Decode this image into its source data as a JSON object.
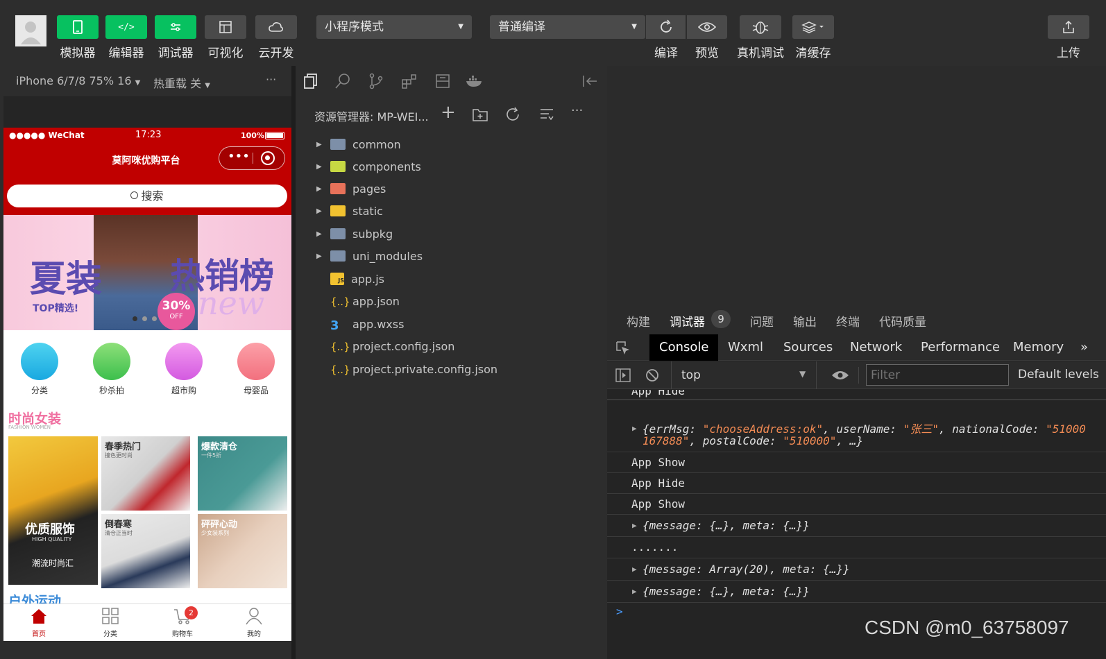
{
  "toolbar": {
    "left_buttons": [
      {
        "label": "模拟器",
        "icon": "phone-icon"
      },
      {
        "label": "编辑器",
        "icon": "code-icon"
      },
      {
        "label": "调试器",
        "icon": "debugger-icon"
      },
      {
        "label": "可视化",
        "icon": "layout-icon"
      },
      {
        "label": "云开发",
        "icon": "cloud-icon"
      }
    ],
    "mode_select": "小程序模式",
    "compile_select": "普通编译",
    "right_buttons": [
      {
        "label": "编译",
        "icon": "refresh-icon"
      },
      {
        "label": "预览",
        "icon": "eye-icon"
      },
      {
        "label": "真机调试",
        "icon": "bug-icon"
      },
      {
        "label": "清缓存",
        "icon": "layers-icon"
      }
    ],
    "upload_label": "上传"
  },
  "simulator": {
    "device": "iPhone 6/7/8 75% 16",
    "hot_reload": "热重载 关",
    "more": "···",
    "status": {
      "carrier": "●●●●● WeChat",
      "time": "17:23",
      "battery": "100%"
    },
    "nav_title": "莫阿咪优购平台",
    "search_placeholder": "搜索",
    "banner": {
      "left": "夏装",
      "right": "热销榜",
      "sub": "TOP精选!",
      "badge": "30%",
      "badge_sub": "OFF",
      "script": "new"
    },
    "categories": [
      "分类",
      "秒杀拍",
      "超市购",
      "母婴品"
    ],
    "section1": {
      "title": "时尚女装",
      "sub": "FASHION WOMEN"
    },
    "tiles": [
      {
        "title": "优质服饰",
        "sub": "HIGH QUALITY",
        "sub2": "潮流时尚汇"
      },
      {
        "title": "春季热门",
        "sub": "撞色更时尚"
      },
      {
        "title": "爆款清仓",
        "sub": "一件5折"
      },
      {
        "title": "倒春寒",
        "sub": "清仓正当时"
      },
      {
        "title": "砰砰心动",
        "sub": "少女装系列"
      }
    ],
    "section2": {
      "title": "户外运动"
    },
    "tabbar": [
      {
        "label": "首页",
        "active": true
      },
      {
        "label": "分类"
      },
      {
        "label": "购物车",
        "badge": "2"
      },
      {
        "label": "我的"
      }
    ]
  },
  "explorer": {
    "title": "资源管理器: MP-WEI...",
    "items": [
      {
        "name": "common",
        "type": "folder",
        "color": "#7d8fa8"
      },
      {
        "name": "components",
        "type": "folder",
        "color": "#c6d843"
      },
      {
        "name": "pages",
        "type": "folder",
        "color": "#e8725a"
      },
      {
        "name": "static",
        "type": "folder",
        "color": "#f2c230"
      },
      {
        "name": "subpkg",
        "type": "folder",
        "color": "#7d8fa8"
      },
      {
        "name": "uni_modules",
        "type": "folder",
        "color": "#7d8fa8"
      },
      {
        "name": "app.js",
        "type": "js"
      },
      {
        "name": "app.json",
        "type": "json"
      },
      {
        "name": "app.wxss",
        "type": "css"
      },
      {
        "name": "project.config.json",
        "type": "json"
      },
      {
        "name": "project.private.config.json",
        "type": "json"
      }
    ]
  },
  "debugger": {
    "panel_tabs": [
      "构建",
      "调试器",
      "问题",
      "输出",
      "终端",
      "代码质量"
    ],
    "debug_count": "9",
    "console_tabs": [
      "Console",
      "Wxml",
      "Sources",
      "Network",
      "Performance",
      "Memory"
    ],
    "more_tabs": "»",
    "context": "top",
    "filter_placeholder": "Filter",
    "levels": "Default levels",
    "logs": {
      "l0": "App Hide",
      "l1a_key1": "errMsg",
      "l1a_val1": "\"chooseAddress:ok\"",
      "l1a_key2": "userName",
      "l1a_val2": "\"张三\"",
      "l1a_key3": "nationalCode",
      "l1a_val3": "\"51000",
      "l1b_val": "167888\"",
      "l1b_key": "postalCode",
      "l1b_val2": "\"510000\"",
      "l2": "App Show",
      "l3": "App Hide",
      "l4": "App Show",
      "l5": "{message: {…}, meta: {…}}",
      "l6": ".......",
      "l7": "{message: Array(20), meta: {…}}",
      "l8": "{message: {…}, meta: {…}}"
    },
    "prompt": ">"
  },
  "watermark": "CSDN @m0_63758097"
}
